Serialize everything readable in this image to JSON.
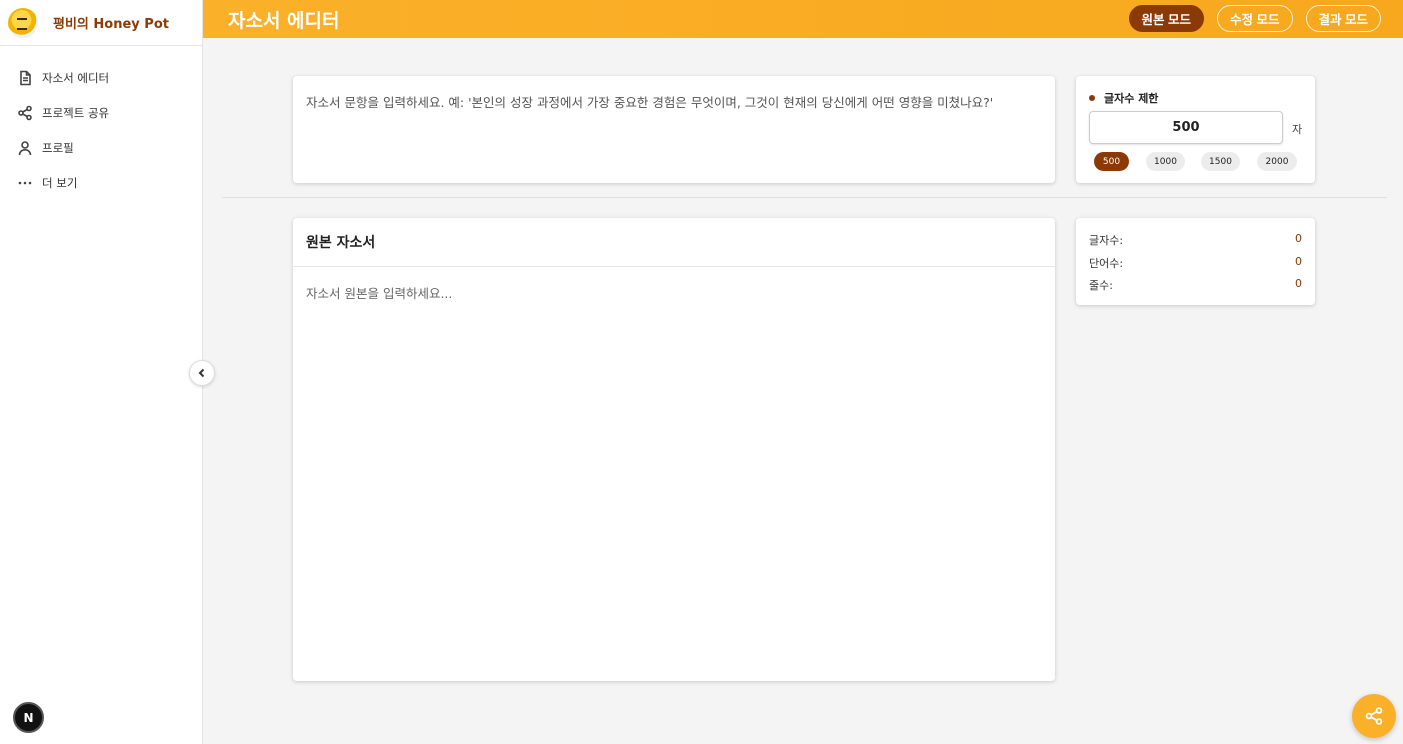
{
  "brand": {
    "name": "평비의 Honey Pot"
  },
  "sidebar": {
    "items": [
      {
        "label": "자소서 에디터",
        "icon": "document-icon"
      },
      {
        "label": "프로젝트 공유",
        "icon": "share-icon"
      },
      {
        "label": "프로필",
        "icon": "user-icon"
      },
      {
        "label": "더 보기",
        "icon": "more-icon"
      }
    ]
  },
  "header": {
    "title": "자소서 에디터",
    "modes": [
      {
        "label": "원본 모드",
        "active": true
      },
      {
        "label": "수정 모드",
        "active": false
      },
      {
        "label": "결과 모드",
        "active": false
      }
    ]
  },
  "question": {
    "placeholder": "자소서 문항을 입력하세요. 예: '본인의 성장 과정에서 가장 중요한 경험은 무엇이며, 그것이 현재의 당신에게 어떤 영향을 미쳤나요?'"
  },
  "char_limit": {
    "title": "글자수 제한",
    "value": "500",
    "unit": "자",
    "presets": [
      "500",
      "1000",
      "1500",
      "2000"
    ],
    "selected": "500"
  },
  "editor": {
    "title": "원본 자소서",
    "placeholder": "자소서 원본을 입력하세요..."
  },
  "stats": {
    "chars_label": "글자수:",
    "chars_value": "0",
    "words_label": "단어수:",
    "words_value": "0",
    "lines_label": "줄수:",
    "lines_value": "0"
  },
  "badge": {
    "letter": "N"
  },
  "colors": {
    "accent": "#fbb02a",
    "brand_dark": "#8b3a06"
  }
}
